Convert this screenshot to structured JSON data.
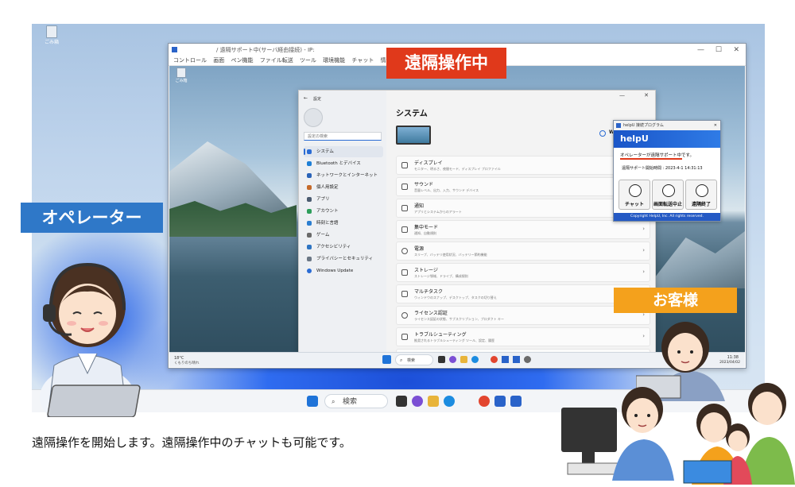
{
  "desktop": {
    "recycle_bin_label": "ごみ箱"
  },
  "remote_window": {
    "title": "/ 遠隔サポート中(サーバ経由接続) - IP:",
    "menu": [
      "コントロール",
      "画面",
      "ペン機能",
      "ファイル転送",
      "ツール",
      "環境機能",
      "チャット",
      "情報"
    ],
    "inner_recycle_label": "ごみ箱"
  },
  "settings": {
    "back_label": "←",
    "app_label": "設定",
    "search_placeholder": "設定の検索",
    "page_title": "システム",
    "device_label": "Win",
    "sidebar": [
      {
        "label": "システム",
        "color": "#2b6cd4"
      },
      {
        "label": "Bluetooth とデバイス",
        "color": "#1f7fd6"
      },
      {
        "label": "ネットワークとインターネット",
        "color": "#2a63b8"
      },
      {
        "label": "個人用設定",
        "color": "#c56a2a"
      },
      {
        "label": "アプリ",
        "color": "#4b5b70"
      },
      {
        "label": "アカウント",
        "color": "#2e9e5b"
      },
      {
        "label": "時刻と言語",
        "color": "#2b7ed0"
      },
      {
        "label": "ゲーム",
        "color": "#6a6a6a"
      },
      {
        "label": "アクセシビリティ",
        "color": "#2d74c2"
      },
      {
        "label": "プライバシーとセキュリティ",
        "color": "#6b7785"
      },
      {
        "label": "Windows Update",
        "color": "#2b6cd4"
      }
    ],
    "rows": [
      {
        "title": "ディスプレイ",
        "sub": "モニター、明るさ、夜間モード、ディスプレイ プロファイル"
      },
      {
        "title": "サウンド",
        "sub": "音量レベル、出力、入力、サウンド デバイス"
      },
      {
        "title": "通知",
        "sub": "アプリとシステムからのアラート"
      },
      {
        "title": "集中モード",
        "sub": "通知、自動規則"
      },
      {
        "title": "電源",
        "sub": "スリープ、バッテリ使用状況、バッテリー節約機能"
      },
      {
        "title": "ストレージ",
        "sub": "ストレージ領域、ドライブ、構成規則"
      },
      {
        "title": "マルチタスク",
        "sub": "ウィンドウのスナップ、デスクトップ、タスクの切り替え"
      },
      {
        "title": "ライセンス認証",
        "sub": "ライセンス認証の状態、サブスクリプション、プロダクト キー"
      },
      {
        "title": "トラブルシューティング",
        "sub": "推奨されるトラブルシューティング ツール、設定、履歴"
      },
      {
        "title": "回復",
        "sub": "リセット、スタートアップの詳細設定、戻る"
      }
    ]
  },
  "helpu": {
    "window_title": "helpU 接続プログラム",
    "logo": "helpU",
    "status_message": "オペレーターが遠隔サポート中です。",
    "start_time": "遠隔サポート開始時間 : 2023-4-1 14:31:13",
    "buttons": [
      {
        "label": "チャット",
        "icon": "chat-bubble-icon"
      },
      {
        "label": "画面転送中止",
        "icon": "pause-icon"
      },
      {
        "label": "遠隔終了",
        "icon": "stop-icon"
      }
    ],
    "copyright": "Copyright HelpU, Inc. All rights reserved."
  },
  "inner_taskbar": {
    "weather_temp": "18°C",
    "weather_desc": "くもりのち晴れ",
    "search_label": "検索",
    "time": "11:38",
    "date": "2023/04/02"
  },
  "outer_taskbar": {
    "search_label": "検索"
  },
  "banners": {
    "remote_active": "遠隔操作中",
    "operator": "オペレーター",
    "customer": "お客様"
  },
  "caption": "遠隔操作を開始します。遠隔操作中のチャットも可能です。",
  "colors": {
    "remote_banner": "#e0391b",
    "operator_banner": "#2f78c8",
    "customer_banner": "#f4a11c",
    "helpu_header": "#1f63d8"
  }
}
